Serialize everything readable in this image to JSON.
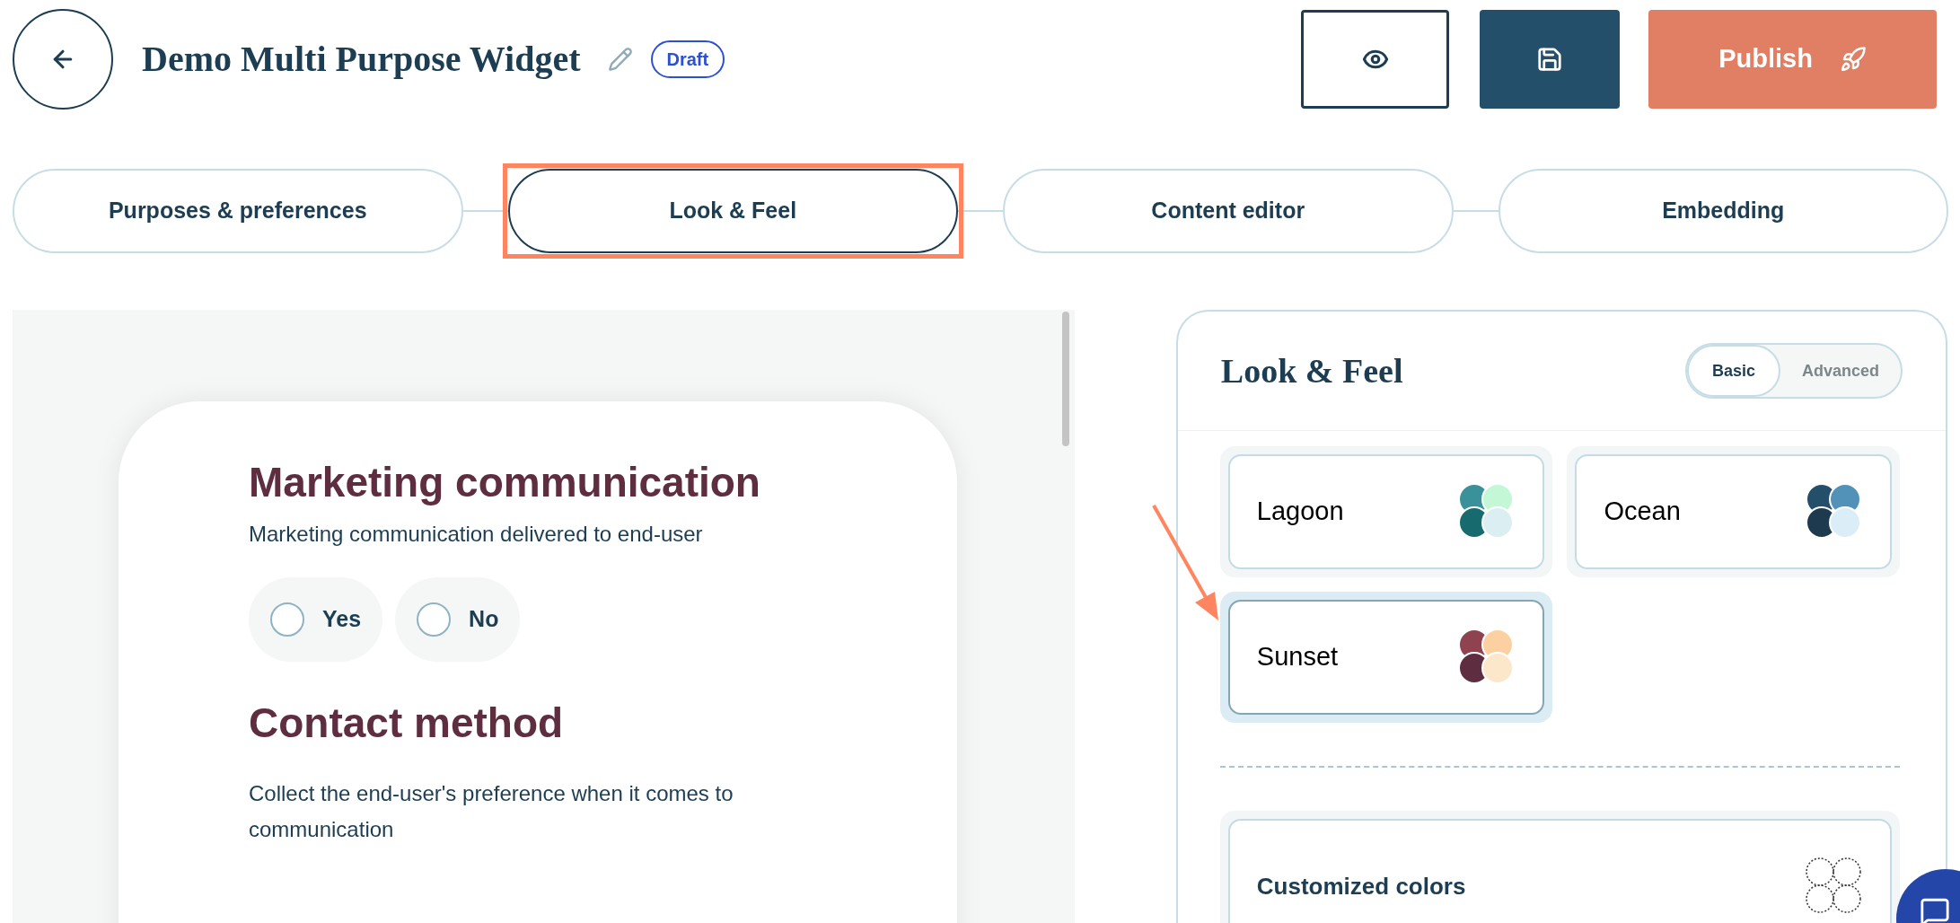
{
  "header": {
    "title": "Demo Multi Purpose Widget",
    "status_badge": "Draft",
    "publish_button": {
      "label": "Publish"
    }
  },
  "steps": [
    {
      "label": "Purposes & preferences",
      "selected": false,
      "highlighted": false
    },
    {
      "label": "Look & Feel",
      "selected": true,
      "highlighted": true
    },
    {
      "label": "Content editor",
      "selected": false,
      "highlighted": false
    },
    {
      "label": "Embedding",
      "selected": false,
      "highlighted": false
    }
  ],
  "preview": {
    "sections": [
      {
        "title": "Marketing communication",
        "description": "Marketing communication delivered to end-user",
        "options": [
          {
            "label": "Yes",
            "selected": false
          },
          {
            "label": "No",
            "selected": false
          }
        ]
      },
      {
        "title": "Contact method",
        "description": "Collect the end-user's preference when it comes to communication"
      }
    ]
  },
  "look_and_feel": {
    "title": "Look & Feel",
    "modes": [
      {
        "label": "Basic",
        "selected": true
      },
      {
        "label": "Advanced",
        "selected": false
      }
    ],
    "themes": [
      {
        "name": "Lagoon",
        "selected": false,
        "pointed": false,
        "swatches": [
          {
            "color": "#3a9199"
          },
          {
            "color": "#c3f7d6"
          },
          {
            "color": "#176a6e"
          },
          {
            "color": "#dbeff2"
          }
        ]
      },
      {
        "name": "Ocean",
        "selected": false,
        "pointed": false,
        "swatches": [
          {
            "color": "#234f6a"
          },
          {
            "color": "#5292b8"
          },
          {
            "color": "#1e3a4f"
          },
          {
            "color": "#dbeef7"
          }
        ]
      },
      {
        "name": "Sunset",
        "selected": true,
        "pointed": true,
        "swatches": [
          {
            "color": "#8f4250"
          },
          {
            "color": "#fdd0a2"
          },
          {
            "color": "#5e2d40"
          },
          {
            "color": "#fde7ca"
          }
        ]
      }
    ],
    "custom": {
      "label": "Customized colors"
    }
  }
}
